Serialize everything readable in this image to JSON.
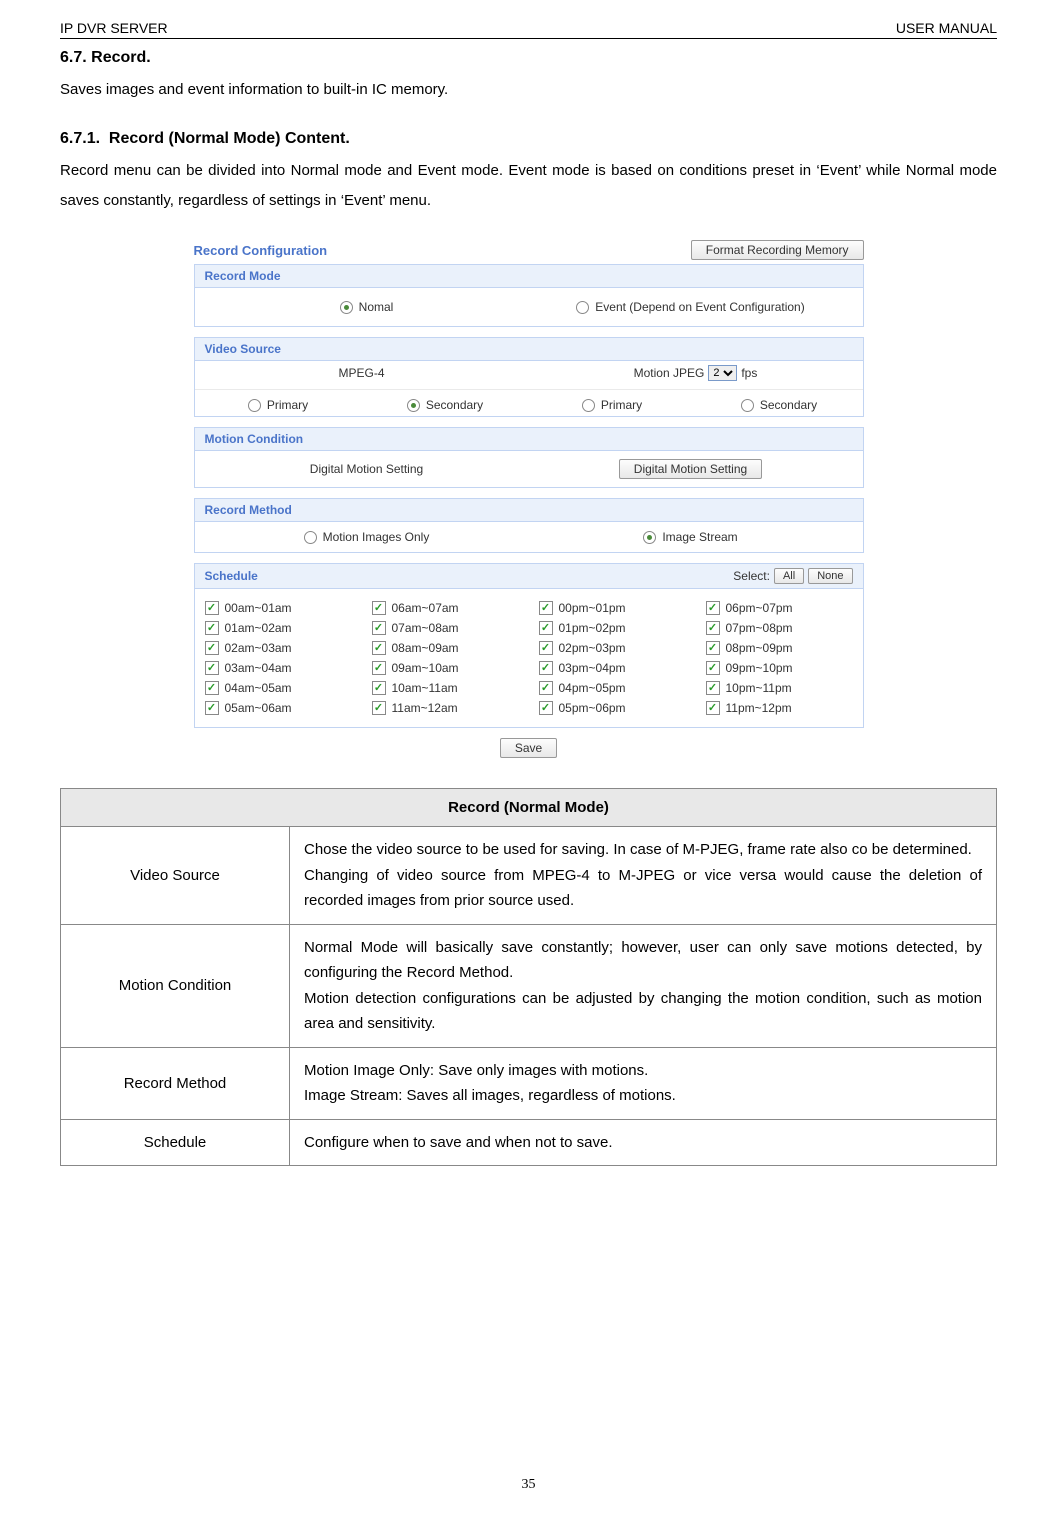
{
  "header": {
    "left": "IP DVR SERVER",
    "right": "USER MANUAL"
  },
  "section_67": {
    "num": "6.7.",
    "title": "Record.",
    "text": "Saves images and event information to built-in IC memory."
  },
  "section_671": {
    "num": "6.7.1.",
    "title": "Record (Normal Mode) Content.",
    "text": "Record menu can be divided into Normal mode and Event mode. Event mode is based on conditions preset in ‘Event’ while Normal mode saves constantly, regardless of settings in ‘Event’ menu."
  },
  "config": {
    "main_title": "Record Configuration",
    "format_btn": "Format Recording Memory",
    "record_mode": {
      "head": "Record Mode",
      "normal": "Nomal",
      "event": "Event (Depend on Event Configuration)"
    },
    "video_source": {
      "head": "Video Source",
      "mpeg": "MPEG-4",
      "mjpeg": "Motion JPEG",
      "fps_value": "2",
      "fps_label": "fps",
      "primary": "Primary",
      "secondary": "Secondary"
    },
    "motion_condition": {
      "head": "Motion Condition",
      "label": "Digital Motion Setting",
      "button": "Digital Motion Setting"
    },
    "record_method": {
      "head": "Record Method",
      "motion_only": "Motion Images Only",
      "image_stream": "Image Stream"
    },
    "schedule": {
      "head": "Schedule",
      "select_label": "Select:",
      "all": "All",
      "none": "None",
      "items": [
        "00am~01am",
        "06am~07am",
        "00pm~01pm",
        "06pm~07pm",
        "01am~02am",
        "07am~08am",
        "01pm~02pm",
        "07pm~08pm",
        "02am~03am",
        "08am~09am",
        "02pm~03pm",
        "08pm~09pm",
        "03am~04am",
        "09am~10am",
        "03pm~04pm",
        "09pm~10pm",
        "04am~05am",
        "10am~11am",
        "04pm~05pm",
        "10pm~11pm",
        "05am~06am",
        "11am~12am",
        "05pm~06pm",
        "11pm~12pm"
      ]
    },
    "save_btn": "Save"
  },
  "table": {
    "header": "Record (Normal Mode)",
    "rows": [
      {
        "label": "Video Source",
        "desc": "Chose the video source to be used for saving. In case of M-PJEG, frame rate also co be determined.\nChanging of video source from MPEG-4 to M-JPEG or vice versa would cause the deletion of recorded images from prior source used."
      },
      {
        "label": "Motion Condition",
        "desc": "Normal Mode will basically save constantly; however, user can only save motions detected, by configuring the Record Method.\nMotion detection configurations can be adjusted by changing the motion condition, such as motion area and sensitivity."
      },
      {
        "label": "Record Method",
        "desc": "Motion Image Only: Save only images with motions.\nImage Stream: Saves all images, regardless of motions."
      },
      {
        "label": "Schedule",
        "desc": "Configure when to save and when not to save."
      }
    ]
  },
  "page_number": "35"
}
